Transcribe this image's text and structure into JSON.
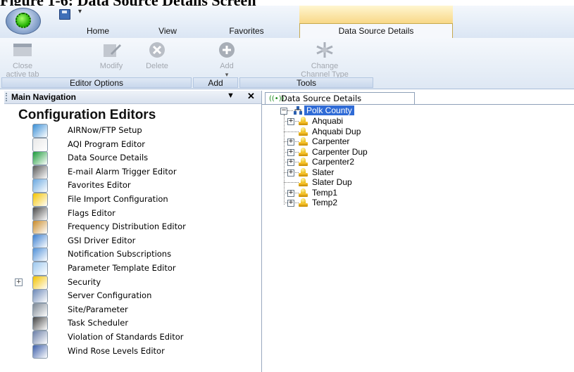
{
  "caption": "Figure 1-6: Data Source Details Screen",
  "ribbon": {
    "tabs": [
      {
        "label": "Home",
        "active": false
      },
      {
        "label": "View",
        "active": false
      },
      {
        "label": "Favorites",
        "active": false
      },
      {
        "label": "Data Source Details",
        "active": true
      }
    ],
    "buttons": {
      "close": "Close active tab",
      "close_line1": "Close",
      "close_line2": "active tab",
      "modify": "Modify",
      "delete": "Delete",
      "add": "Add",
      "change_line1": "Change",
      "change_line2": "Channel Type"
    },
    "groups": {
      "editor_options": "Editor Options",
      "add": "Add",
      "tools": "Tools"
    }
  },
  "nav": {
    "header": "Main Navigation",
    "pin_glyph": "▼",
    "close_glyph": "✕",
    "title": "Configuration Editors",
    "items": [
      {
        "label": "AIRNow/FTP Setup",
        "icon": "globe-icon"
      },
      {
        "label": "AQI Program Editor",
        "icon": "calendar-icon"
      },
      {
        "label": "Data Source Details",
        "icon": "signal-icon"
      },
      {
        "label": "E-mail Alarm Trigger Editor",
        "icon": "device-icon"
      },
      {
        "label": "Favorites Editor",
        "icon": "favorites-icon"
      },
      {
        "label": "File Import Configuration",
        "icon": "import-icon"
      },
      {
        "label": "Flags Editor",
        "icon": "flag-icon"
      },
      {
        "label": "Frequency Distribution Editor",
        "icon": "clipboard-icon"
      },
      {
        "label": "GSI Driver Editor",
        "icon": "gsi-icon"
      },
      {
        "label": "Notification Subscriptions",
        "icon": "notification-icon"
      },
      {
        "label": "Parameter Template Editor",
        "icon": "template-icon"
      },
      {
        "label": "Security",
        "icon": "folder-icon",
        "expander": "+"
      },
      {
        "label": "Server Configuration",
        "icon": "server-icon"
      },
      {
        "label": "Site/Parameter",
        "icon": "gear-icon"
      },
      {
        "label": "Task Scheduler",
        "icon": "scheduler-icon"
      },
      {
        "label": "Violation of Standards Editor",
        "icon": "books-icon"
      },
      {
        "label": "Wind Rose Levels Editor",
        "icon": "windrose-icon"
      }
    ]
  },
  "details": {
    "tab_label": "Data Source Details",
    "root": "Polk County",
    "nodes": [
      {
        "label": "Ahquabi",
        "expandable": true
      },
      {
        "label": "Ahquabi Dup",
        "expandable": false
      },
      {
        "label": "Carpenter",
        "expandable": true
      },
      {
        "label": "Carpenter Dup",
        "expandable": true
      },
      {
        "label": "Carpenter2",
        "expandable": true
      },
      {
        "label": "Slater",
        "expandable": true
      },
      {
        "label": "Slater Dup",
        "expandable": false
      },
      {
        "label": "Temp1",
        "expandable": true
      },
      {
        "label": "Temp2",
        "expandable": true
      }
    ]
  },
  "colors": {
    "accent": "#2f6bd6",
    "ribbon_border": "#9db4d4",
    "contextual_tab": "#f8d888"
  }
}
